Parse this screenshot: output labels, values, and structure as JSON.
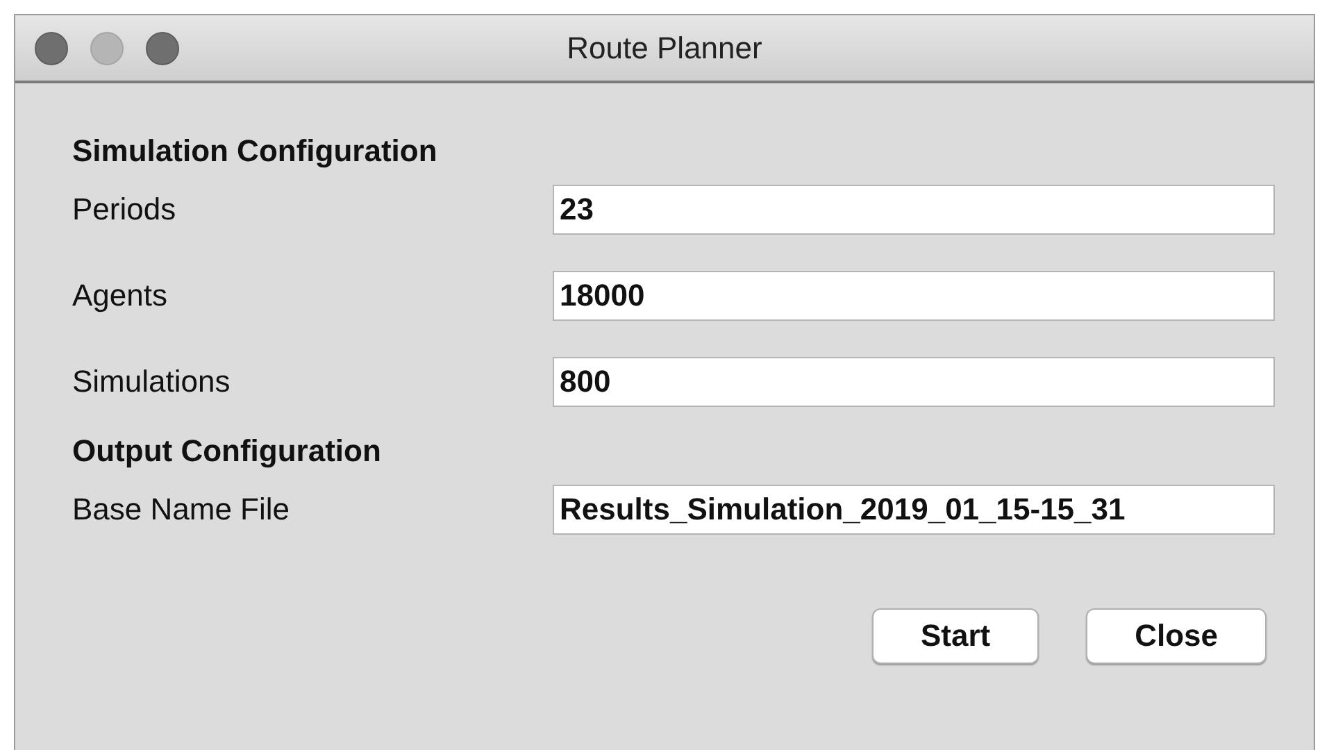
{
  "window": {
    "title": "Route Planner"
  },
  "sections": [
    {
      "heading": "Simulation Configuration",
      "fields": [
        {
          "label": "Periods",
          "value": "23"
        },
        {
          "label": "Agents",
          "value": "18000"
        },
        {
          "label": "Simulations",
          "value": "800"
        }
      ]
    },
    {
      "heading": "Output Configuration",
      "fields": [
        {
          "label": "Base Name File",
          "value": "Results_Simulation_2019_01_15-15_31"
        }
      ]
    }
  ],
  "buttons": [
    "Start",
    "Close"
  ]
}
